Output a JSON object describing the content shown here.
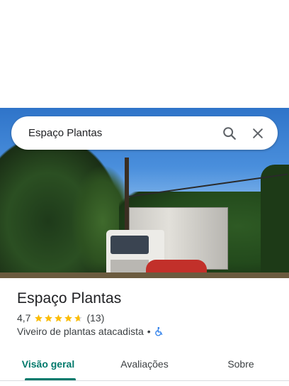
{
  "search": {
    "query": "Espaço Plantas"
  },
  "place": {
    "name": "Espaço Plantas",
    "rating": "4,7",
    "review_count": "(13)",
    "category": "Viveiro de plantas atacadista",
    "separator": "•"
  },
  "tabs": [
    {
      "label": "Visão geral",
      "active": true
    },
    {
      "label": "Avaliações",
      "active": false
    },
    {
      "label": "Sobre",
      "active": false
    }
  ],
  "colors": {
    "accent": "#00796b",
    "star": "#fbbc04",
    "accessibility": "#1a73e8"
  },
  "icons": [
    "search-icon",
    "close-icon",
    "star-icon",
    "half-star-icon",
    "wheelchair-icon"
  ]
}
